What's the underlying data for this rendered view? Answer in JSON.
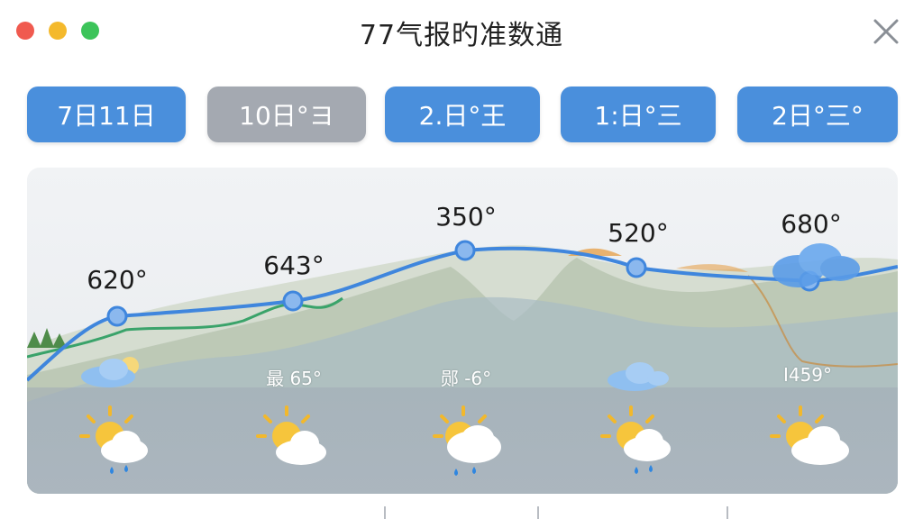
{
  "window": {
    "title": "77气报旳准数通"
  },
  "tabs": [
    {
      "label": "7日11日",
      "active": true
    },
    {
      "label": "10日°ヨ",
      "active": false
    },
    {
      "label": "2.日°王",
      "active": true
    },
    {
      "label": "1:日°三",
      "active": true
    },
    {
      "label": "2日°三°",
      "active": true
    }
  ],
  "forecast": {
    "highs": [
      "620°",
      "643°",
      "350°",
      "520°",
      "680°"
    ],
    "lows": [
      "",
      "最 65°",
      "郧 -6°",
      "",
      "I459°"
    ],
    "icons": [
      "sun-cloud-rain-icon",
      "sun-cloud-icon",
      "sun-cloud-rain-icon",
      "sun-cloud-rain-icon",
      "sun-cloud-icon"
    ]
  },
  "colors": {
    "accent": "#4a8fdc",
    "inactive_tab": "#a4a9b1",
    "line": "#3f86dd",
    "green_line": "#3aa36a"
  }
}
